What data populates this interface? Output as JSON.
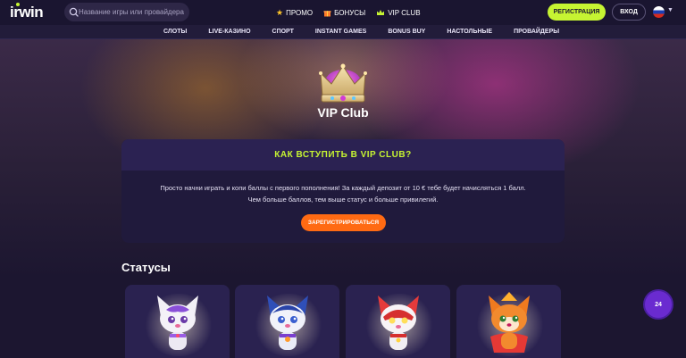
{
  "header": {
    "logo": "irwin",
    "search_placeholder": "Название игры или провайдера",
    "nav": [
      {
        "label": "ПРОМО",
        "icon": "star-icon"
      },
      {
        "label": "БОНУСЫ",
        "icon": "gift-icon"
      },
      {
        "label": "VIP CLUB",
        "icon": "crown-icon"
      }
    ],
    "register_label": "РЕГИСТРАЦИЯ",
    "login_label": "ВХОД",
    "language_flag": "ru-flag-icon"
  },
  "categories": [
    "СЛОТЫ",
    "LIVE-КАЗИНО",
    "СПОРТ",
    "INSTANT GAMES",
    "BONUS BUY",
    "НАСТОЛЬНЫЕ",
    "ПРОВАЙДЕРЫ"
  ],
  "hero": {
    "title": "VIP Club"
  },
  "join": {
    "title": "КАК ВСТУПИТЬ В VIP CLUB?",
    "line1": "Просто начни играть и копи баллы с первого пополнения! За каждый депозит от 10 € тебе будет начисляться 1 балл.",
    "line2": "Чем больше баллов, тем выше статус и больше привилегий.",
    "button_label": "ЗАРЕГИСТРИРОВАТЬСЯ"
  },
  "statuses": {
    "title": "Статусы"
  },
  "support": {
    "label": "24"
  },
  "colors": {
    "accent_lime": "#c6f432",
    "accent_orange": "#ff6a13",
    "bg_dark": "#1c1630",
    "card_bg": "#201a3c"
  }
}
